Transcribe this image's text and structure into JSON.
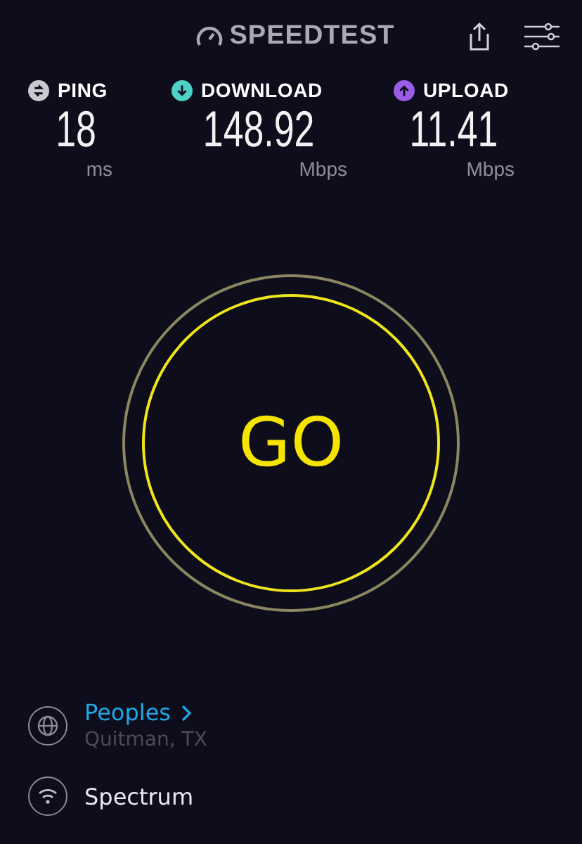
{
  "header": {
    "logo": "SPEEDTEST"
  },
  "metrics": [
    {
      "label": "PING",
      "value": "18",
      "unit": "ms",
      "kind": "ping",
      "color": "#c9c9d0"
    },
    {
      "label": "DOWNLOAD",
      "value": "148.92",
      "unit": "Mbps",
      "kind": "download",
      "color": "#4fd1c5"
    },
    {
      "label": "UPLOAD",
      "value": "11.41",
      "unit": "Mbps",
      "kind": "upload",
      "color": "#9b5de5"
    }
  ],
  "go_button": {
    "label": "GO"
  },
  "server": {
    "name": "Peoples",
    "location": "Quitman, TX"
  },
  "provider": {
    "name": "Spectrum"
  }
}
